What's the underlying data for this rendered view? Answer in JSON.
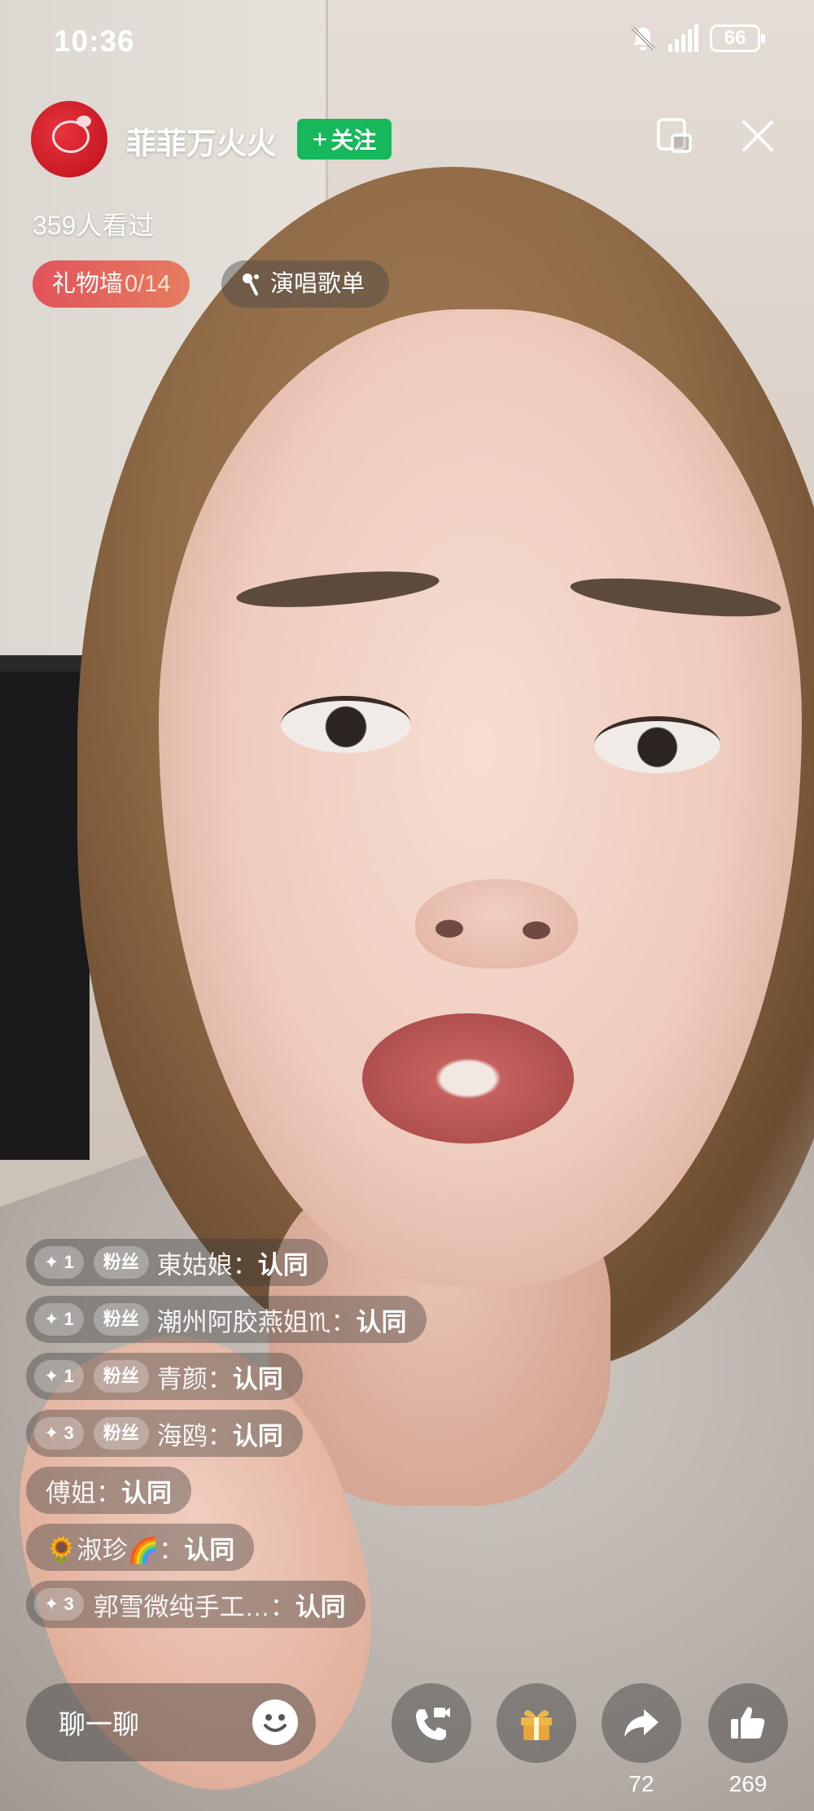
{
  "status_bar": {
    "time": "10:36",
    "battery": "66"
  },
  "header": {
    "anchor_name": "菲菲万火火",
    "follow_label": "关注",
    "viewers": "359人看过",
    "gift_wall_label": "礼物墙",
    "gift_wall_count": "0/14",
    "song_list_label": "演唱歌单"
  },
  "comments": [
    {
      "level": "1",
      "fan": "粉丝",
      "name": "東姑娘",
      "text": "认同"
    },
    {
      "level": "1",
      "fan": "粉丝",
      "name": "潮州阿胶燕姐♏",
      "text": "认同"
    },
    {
      "level": "1",
      "fan": "粉丝",
      "name": "青颜",
      "text": "认同"
    },
    {
      "level": "3",
      "fan": "粉丝",
      "name": "海鸥",
      "text": "认同"
    },
    {
      "name": "傅姐",
      "text": "认同"
    },
    {
      "name": "🌻淑珍🌈",
      "text": "认同"
    },
    {
      "level": "3",
      "name": "郭雪微纯手工…",
      "text": "认同"
    }
  ],
  "bottom_bar": {
    "chat_placeholder": "聊一聊",
    "share_count": "72",
    "like_count": "269"
  },
  "icons": {
    "emoji": "smile-icon",
    "call": "video-call-icon",
    "gift": "gift-icon",
    "share": "share-arrow-icon",
    "like": "thumbs-up-icon"
  },
  "colors": {
    "follow": "#17b85b",
    "gift_wall": "#e1535a"
  }
}
